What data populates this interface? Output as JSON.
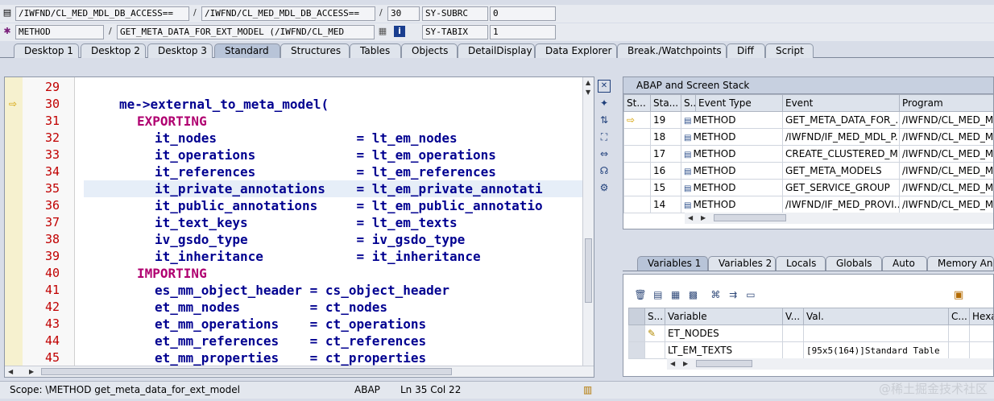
{
  "header": {
    "row1": {
      "program1": "/IWFND/CL_MED_MDL_DB_ACCESS==",
      "program2": "/IWFND/CL_MED_MDL_DB_ACCESS==",
      "line": "30",
      "sysvar": "SY-SUBRC",
      "sysval": "0"
    },
    "row2": {
      "type": "METHOD",
      "event": "GET_META_DATA_FOR_EXT_MODEL (/IWFND/CL_MED",
      "sysvar": "SY-TABIX",
      "sysval": "1"
    },
    "separator": "/"
  },
  "tabs": [
    "Desktop 1",
    "Desktop 2",
    "Desktop 3",
    "Standard",
    "Structures",
    "Tables",
    "Objects",
    "DetailDisplay",
    "Data Explorer",
    "Break./Watchpoints",
    "Diff",
    "Script"
  ],
  "active_tab": "Standard",
  "editor": {
    "lines": [
      {
        "n": "29",
        "text": ""
      },
      {
        "n": "30",
        "text": "me->external_to_meta_model("
      },
      {
        "n": "31",
        "text": "EXPORTING"
      },
      {
        "n": "32",
        "text": "it_nodes                  = lt_em_nodes"
      },
      {
        "n": "33",
        "text": "it_operations             = lt_em_operations"
      },
      {
        "n": "34",
        "text": "it_references             = lt_em_references"
      },
      {
        "n": "35",
        "text": "it_private_annotations    = lt_em_private_annotati"
      },
      {
        "n": "36",
        "text": "it_public_annotations     = lt_em_public_annotatio"
      },
      {
        "n": "37",
        "text": "it_text_keys              = lt_em_texts"
      },
      {
        "n": "38",
        "text": "iv_gsdo_type              = iv_gsdo_type"
      },
      {
        "n": "39",
        "text": "it_inheritance            = it_inheritance"
      },
      {
        "n": "40",
        "text": "IMPORTING"
      },
      {
        "n": "41",
        "text": "es_mm_object_header = cs_object_header"
      },
      {
        "n": "42",
        "text": "et_mm_nodes         = ct_nodes"
      },
      {
        "n": "43",
        "text": "et_mm_operations    = ct_operations"
      },
      {
        "n": "44",
        "text": "et_mm_references    = ct_references"
      },
      {
        "n": "45",
        "text": "et_mm_properties    = ct_properties"
      }
    ]
  },
  "stack": {
    "title": "ABAP and Screen Stack",
    "columns": [
      "St...",
      "Sta...",
      "S...",
      "Event Type",
      "Event",
      "Program"
    ],
    "rows": [
      {
        "level": "19",
        "type": "METHOD",
        "event": "GET_META_DATA_FOR_...",
        "program": "/IWFND/CL_MED_MD"
      },
      {
        "level": "18",
        "type": "METHOD",
        "event": "/IWFND/IF_MED_MDL_P...",
        "program": "/IWFND/CL_MED_MD"
      },
      {
        "level": "17",
        "type": "METHOD",
        "event": "CREATE_CLUSTERED_M...",
        "program": "/IWFND/CL_MED_MD"
      },
      {
        "level": "16",
        "type": "METHOD",
        "event": "GET_META_MODELS",
        "program": "/IWFND/CL_MED_MD"
      },
      {
        "level": "15",
        "type": "METHOD",
        "event": "GET_SERVICE_GROUP",
        "program": "/IWFND/CL_MED_MD"
      },
      {
        "level": "14",
        "type": "METHOD",
        "event": "/IWFND/IF_MED_PROVI...",
        "program": "/IWFND/CL_MED_MD"
      }
    ]
  },
  "var_tabs": [
    "Variables 1",
    "Variables 2",
    "Locals",
    "Globals",
    "Auto",
    "Memory Analy"
  ],
  "active_var_tab": "Variables 1",
  "variables": {
    "columns": [
      "S...",
      "Variable",
      "V...",
      "Val.",
      "C...",
      "Hexa"
    ],
    "rows": [
      {
        "name": "ET_NODES",
        "value": ""
      },
      {
        "name": "LT_EM_TEXTS",
        "value": "[95x5(164)]Standard Table"
      }
    ]
  },
  "status": {
    "scope": "Scope: \\METHOD get_meta_data_for_ext_model",
    "lang": "ABAP",
    "position": "Ln  35 Col  22"
  },
  "watermark": "@稀土掘金技术社区"
}
